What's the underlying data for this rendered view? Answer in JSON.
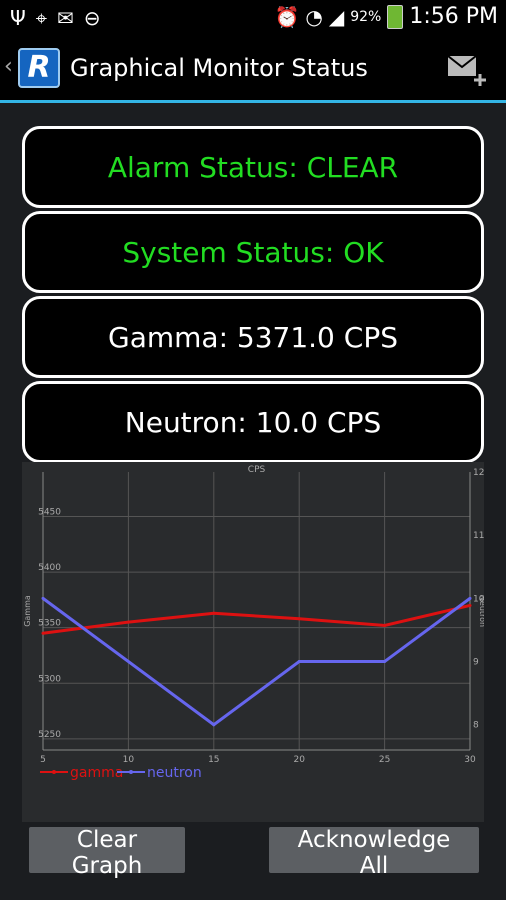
{
  "status_bar": {
    "icons": [
      "usb-icon",
      "gps-icon",
      "mail-icon",
      "do-not-disturb-icon",
      "alarm-icon",
      "wifi-icon",
      "signal-icon",
      "battery-icon"
    ],
    "battery": "92%",
    "time": "1:56 PM"
  },
  "action_bar": {
    "logo_letter": "R",
    "title": "Graphical Monitor Status"
  },
  "status": {
    "alarm": "Alarm Status: CLEAR",
    "system": "System Status: OK",
    "gamma": "Gamma: 5371.0 CPS",
    "neutron": "Neutron: 10.0 CPS"
  },
  "colors": {
    "ok": "#22dd22",
    "gamma": "#dd1111",
    "neutron": "#6666ee",
    "accent": "#33b5e5"
  },
  "chart_data": {
    "type": "line",
    "title": "CPS",
    "x": [
      5,
      10,
      15,
      20,
      25,
      30
    ],
    "ylabel_left": "Gamma",
    "ylabel_right": "Neutron",
    "ylim_left": [
      5240,
      5490
    ],
    "ylim_right": [
      7.6,
      12
    ],
    "yticks_left": [
      5250,
      5300,
      5350,
      5400,
      5450
    ],
    "yticks_right": [
      8,
      9,
      10,
      11,
      12
    ],
    "xticks": [
      5,
      10,
      15,
      20,
      25,
      30
    ],
    "series": [
      {
        "name": "gamma",
        "axis": "left",
        "values": [
          5345,
          5355,
          5363,
          5358,
          5352,
          5370
        ]
      },
      {
        "name": "neutron",
        "axis": "right",
        "values": [
          10,
          null,
          8,
          9,
          9,
          10
        ]
      }
    ],
    "legend": "bottom-left",
    "grid": true
  },
  "buttons": {
    "clear": "Clear Graph",
    "ack": "Acknowledge All"
  }
}
